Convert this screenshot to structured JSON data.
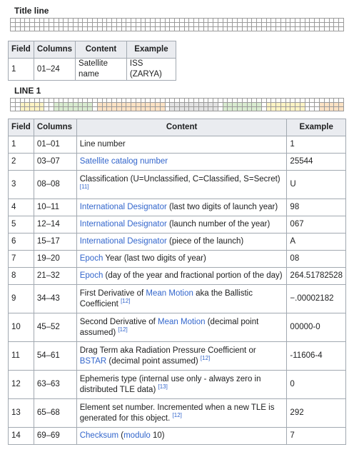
{
  "title_section": {
    "heading": "Title line",
    "headers": [
      "Field",
      "Columns",
      "Content",
      "Example"
    ],
    "rows": [
      {
        "field": "1",
        "columns": "01–24",
        "content": "Satellite name",
        "example": "ISS (ZARYA)"
      }
    ]
  },
  "line1_section": {
    "heading": "LINE 1",
    "headers": [
      "Field",
      "Columns",
      "Content",
      "Example"
    ],
    "rows": [
      {
        "field": "1",
        "columns": "01–01",
        "content_pre": "Line number",
        "link": "",
        "content_post": "",
        "ref": "",
        "example": "1"
      },
      {
        "field": "2",
        "columns": "03–07",
        "content_pre": "",
        "link": "Satellite catalog number",
        "content_post": "",
        "ref": "",
        "example": "25544"
      },
      {
        "field": "3",
        "columns": "08–08",
        "content_pre": "Classification (U=Unclassified, C=Classified, S=Secret)",
        "link": "",
        "content_post": "",
        "ref": "[11]",
        "example": "U"
      },
      {
        "field": "4",
        "columns": "10–11",
        "content_pre": "",
        "link": "International Designator",
        "content_post": " (last two digits of launch year)",
        "ref": "",
        "example": "98"
      },
      {
        "field": "5",
        "columns": "12–14",
        "content_pre": "",
        "link": "International Designator",
        "content_post": " (launch number of the year)",
        "ref": "",
        "example": "067"
      },
      {
        "field": "6",
        "columns": "15–17",
        "content_pre": "",
        "link": "International Designator",
        "content_post": " (piece of the launch)",
        "ref": "",
        "example": "A"
      },
      {
        "field": "7",
        "columns": "19–20",
        "content_pre": "",
        "link": "Epoch",
        "content_post": " Year (last two digits of year)",
        "ref": "",
        "example": "08"
      },
      {
        "field": "8",
        "columns": "21–32",
        "content_pre": "",
        "link": "Epoch",
        "content_post": " (day of the year and fractional portion of the day)",
        "ref": "",
        "example": "264.51782528"
      },
      {
        "field": "9",
        "columns": "34–43",
        "content_pre": "First Derivative of ",
        "link": "Mean Motion",
        "content_post": " aka the Ballistic Coefficient",
        "ref": "[12]",
        "example": "−.00002182"
      },
      {
        "field": "10",
        "columns": "45–52",
        "content_pre": "Second Derivative of ",
        "link": "Mean Motion",
        "content_post": " (decimal point assumed)",
        "ref": "[12]",
        "example": "00000-0"
      },
      {
        "field": "11",
        "columns": "54–61",
        "content_pre": "Drag Term aka Radiation Pressure Coefficient or ",
        "link": "BSTAR",
        "content_post": " (decimal point assumed)",
        "ref": "[12]",
        "example": "-11606-4"
      },
      {
        "field": "12",
        "columns": "63–63",
        "content_pre": "Ephemeris type (internal use only - always zero in distributed TLE data)",
        "link": "",
        "content_post": "",
        "ref": "[13]",
        "example": "0"
      },
      {
        "field": "13",
        "columns": "65–68",
        "content_pre": "Element set number. Incremented when a new TLE is generated for this object.",
        "link": "",
        "content_post": "",
        "ref": "[12]",
        "example": "292"
      },
      {
        "field": "14",
        "columns": "69–69",
        "content_pre": "",
        "link": "Checksum",
        "content_post": " (",
        "link2": "modulo",
        "content_post2": " 10)",
        "ref": "",
        "example": "7"
      }
    ]
  },
  "colors": {
    "link": "#3366cc",
    "header_bg": "#eaecf0",
    "border": "#a2a9b1"
  }
}
